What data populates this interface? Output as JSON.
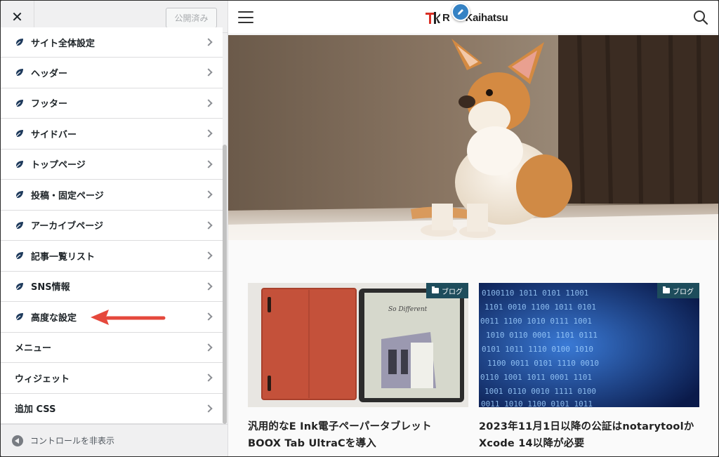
{
  "sidebar": {
    "close_label": "✕",
    "publish_label": "公開済み",
    "items": [
      {
        "label": "サイト全体設定",
        "icon": "cocoon-leaf-icon"
      },
      {
        "label": "ヘッダー",
        "icon": "cocoon-leaf-icon"
      },
      {
        "label": "フッター",
        "icon": "cocoon-leaf-icon"
      },
      {
        "label": "サイドバー",
        "icon": "cocoon-leaf-icon"
      },
      {
        "label": "トップページ",
        "icon": "cocoon-leaf-icon"
      },
      {
        "label": "投稿・固定ページ",
        "icon": "cocoon-leaf-icon"
      },
      {
        "label": "アーカイブページ",
        "icon": "cocoon-leaf-icon"
      },
      {
        "label": "記事一覧リスト",
        "icon": "cocoon-leaf-icon"
      },
      {
        "label": "SNS情報",
        "icon": "cocoon-leaf-icon"
      },
      {
        "label": "高度な設定",
        "icon": "cocoon-leaf-icon"
      },
      {
        "label": "メニュー"
      },
      {
        "label": "ウィジェット"
      },
      {
        "label": "追加 CSS"
      }
    ],
    "footer_label": "コントロールを非表示"
  },
  "preview": {
    "logo_text": "Kaihatsu",
    "logo_prefix": "R",
    "cards": [
      {
        "tag": "ブログ",
        "title_line1": "汎用的なE Ink電子ペーパータブレット",
        "title_line2": "BOOX Tab UltraCを導入"
      },
      {
        "tag": "ブログ",
        "title_line1": "2023年11月1日以降の公証はnotarytoolか",
        "title_line2": "Xcode 14以降が必要"
      }
    ]
  },
  "colors": {
    "accent": "#3582c4",
    "arrow": "#e5483c",
    "tag_bg": "#1e4d5c",
    "leaf_icon": "#1e3a5c"
  }
}
